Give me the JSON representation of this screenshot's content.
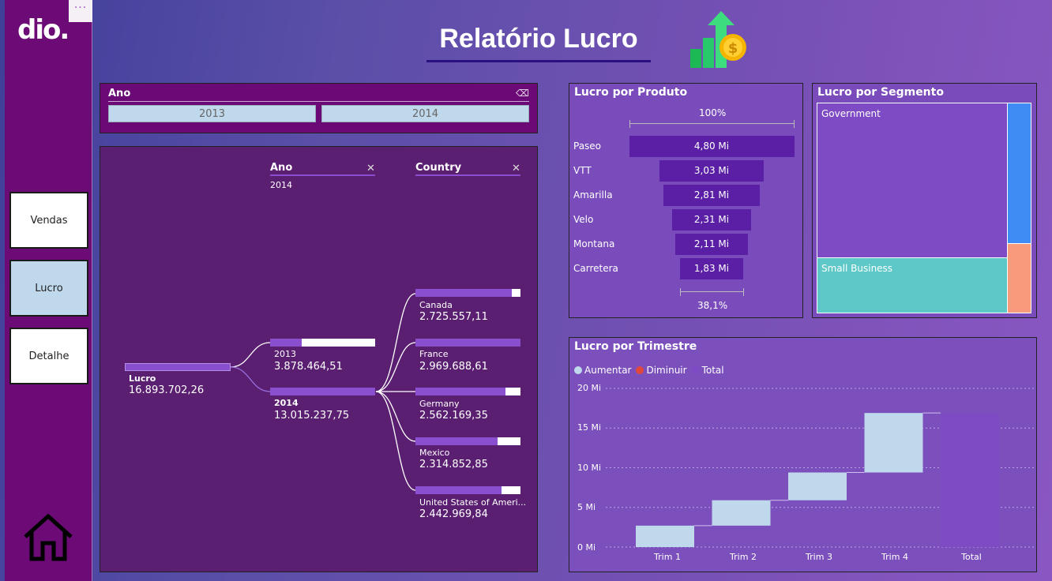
{
  "sidebar": {
    "logo": "dio.",
    "more": "···",
    "buttons": [
      "Vendas",
      "Lucro",
      "Detalhe"
    ],
    "active": "Lucro"
  },
  "header": {
    "title": "Relatório Lucro",
    "icon": "growth-chart-money-icon"
  },
  "slicer": {
    "title": "Ano",
    "options": [
      "2013",
      "2014"
    ]
  },
  "decomposition": {
    "levels": [
      {
        "name": "Ano",
        "selected": "2014"
      },
      {
        "name": "Country",
        "selected": ""
      }
    ],
    "root": {
      "label": "Lucro",
      "value": "16.893.702,26"
    },
    "years": [
      {
        "label": "2013",
        "value": "3.878.464,51",
        "share": 0.3
      },
      {
        "label": "2014",
        "value": "13.015.237,75",
        "share": 1.0
      }
    ],
    "countries": [
      {
        "label": "Canada",
        "value": "2.725.557,11",
        "share": 0.92
      },
      {
        "label": "France",
        "value": "2.969.688,61",
        "share": 1.0
      },
      {
        "label": "Germany",
        "value": "2.562.169,35",
        "share": 0.86
      },
      {
        "label": "Mexico",
        "value": "2.314.852,85",
        "share": 0.78
      },
      {
        "label": "United States of Ameri...",
        "value": "2.442.969,84",
        "share": 0.82
      }
    ]
  },
  "funnel": {
    "title": "Lucro por Produto",
    "top_pct": "100%",
    "bottom_pct": "38,1%",
    "rows": [
      {
        "label": "Paseo",
        "value_label": "4,80 Mi",
        "value": 4.8
      },
      {
        "label": "VTT",
        "value_label": "3,03 Mi",
        "value": 3.03
      },
      {
        "label": "Amarilla",
        "value_label": "2,81 Mi",
        "value": 2.81
      },
      {
        "label": "Velo",
        "value_label": "2,31 Mi",
        "value": 2.31
      },
      {
        "label": "Montana",
        "value_label": "2,11 Mi",
        "value": 2.11
      },
      {
        "label": "Carretera",
        "value_label": "1,83 Mi",
        "value": 1.83
      }
    ]
  },
  "treemap": {
    "title": "Lucro por Segmento",
    "cells": [
      {
        "label": "Government",
        "color": "#7f4bc4"
      },
      {
        "label": "Small Business",
        "color": "#5ec8c8"
      },
      {
        "label": "",
        "color": "#3f8cf5"
      },
      {
        "label": "",
        "color": "#f79b7c"
      }
    ]
  },
  "waterfall": {
    "title": "Lucro por Trimestre",
    "legend": [
      {
        "label": "Aumentar",
        "color": "#bfd8ec"
      },
      {
        "label": "Diminuir",
        "color": "#e0483d"
      },
      {
        "label": "Total",
        "color": "#7f4bc4"
      }
    ],
    "y_ticks": [
      "20 Mi",
      "15 Mi",
      "10 Mi",
      "5 Mi",
      "0 Mi"
    ]
  },
  "chart_data": {
    "type": "bar",
    "title": "Lucro por Trimestre",
    "categories": [
      "Trim 1",
      "Trim 2",
      "Trim 3",
      "Trim 4",
      "Total"
    ],
    "series": [
      {
        "name": "Aumentar",
        "values": [
          2.7,
          3.2,
          3.5,
          7.5,
          null
        ]
      },
      {
        "name": "Total",
        "values": [
          null,
          null,
          null,
          null,
          16.9
        ]
      }
    ],
    "ylim": [
      0,
      20
    ],
    "grid": true,
    "legend": "top-left"
  }
}
